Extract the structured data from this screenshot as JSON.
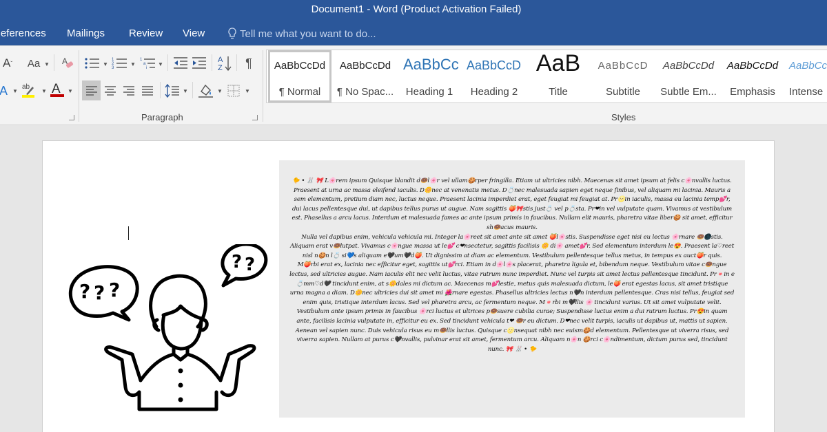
{
  "window": {
    "title": "Document1 - Word (Product Activation Failed)"
  },
  "tabs": [
    {
      "label": "References"
    },
    {
      "label": "Mailings"
    },
    {
      "label": "Review"
    },
    {
      "label": "View"
    }
  ],
  "tell_me": {
    "placeholder": "Tell me what you want to do...",
    "icon": "lightbulb-icon"
  },
  "ribbon": {
    "font_group": {
      "buttons": [
        {
          "name": "grow-font",
          "icon": "font-size-icon",
          "glyph": "A"
        },
        {
          "name": "change-case",
          "icon": "change-case-icon",
          "glyph": "Aa"
        },
        {
          "name": "clear-formatting",
          "icon": "clear-formatting-icon"
        },
        {
          "name": "text-effects",
          "icon": "text-effects-icon",
          "glyph": "A"
        },
        {
          "name": "highlight",
          "icon": "highlighter-icon",
          "glyph": "ab",
          "color": "#ffff00"
        },
        {
          "name": "font-color",
          "icon": "font-color-icon",
          "glyph": "A",
          "color": "#c00000"
        }
      ]
    },
    "paragraph_group": {
      "label": "Paragraph",
      "buttons": [
        {
          "name": "bullets",
          "icon": "bullets-icon"
        },
        {
          "name": "numbering",
          "icon": "numbering-icon"
        },
        {
          "name": "multilevel-list",
          "icon": "multilevel-list-icon"
        },
        {
          "name": "decrease-indent",
          "icon": "decrease-indent-icon"
        },
        {
          "name": "increase-indent",
          "icon": "increase-indent-icon"
        },
        {
          "name": "sort",
          "icon": "sort-az-icon"
        },
        {
          "name": "show-hide",
          "icon": "pilcrow-icon",
          "glyph": "¶"
        },
        {
          "name": "align-left",
          "icon": "align-left-icon",
          "active": true
        },
        {
          "name": "align-center",
          "icon": "align-center-icon"
        },
        {
          "name": "align-right",
          "icon": "align-right-icon"
        },
        {
          "name": "justify",
          "icon": "justify-icon"
        },
        {
          "name": "line-spacing",
          "icon": "line-spacing-icon"
        },
        {
          "name": "shading",
          "icon": "shading-icon"
        },
        {
          "name": "borders",
          "icon": "borders-icon"
        }
      ]
    },
    "styles_group": {
      "label": "Styles",
      "items": [
        {
          "sample": "AaBbCcDd",
          "name": "¶ Normal",
          "selected": true
        },
        {
          "sample": "AaBbCcDd",
          "name": "¶ No Spac..."
        },
        {
          "sample": "AaBbCc",
          "name": "Heading 1"
        },
        {
          "sample": "AaBbCcD",
          "name": "Heading 2"
        },
        {
          "sample": "AaB",
          "name": "Title"
        },
        {
          "sample": "AaBbCcD",
          "name": "Subtitle"
        },
        {
          "sample": "AaBbCcDd",
          "name": "Subtle Em..."
        },
        {
          "sample": "AaBbCcDd",
          "name": "Emphasis"
        },
        {
          "sample": "AaBbCc",
          "name": "Intense"
        }
      ]
    }
  },
  "document": {
    "paragraphs": [
      "🐤 • 🐰 🎀 L🌸rem ipsum Quisque blandit d🍩l🌸r vel ullam🍪rper fringilla. Etiam ut ultricies nibh. Maecenas sit amet ipsum at felis c🌸nvallis luctus. Praesent at urna ac massa eleifend iaculis. D🌼nec at venenatis metus. D💍nec malesuada sapien eget neque finibus, vel aliquam mi lacinia. Mauris a sem elementum, pretium diam nec, luctus neque. Praesent lacinia imperdiet erat, eget feugiat mi feugiat at. Pr🌝in iaculis, massa eu lacinia temp💕r, dui lacus pellentesque dui, ut dapibus tellus purus ut augue. Nam sagittis 🍑🎀stis just💍 vel p💍sta. Pr❤in vel vulputate quam. Vivamus at vestibulum est. Phasellus a arcu lacus. Interdum et malesuada fames ac ante ipsum primis in faucibus. Nullam elit mauris, pharetra vitae liber🍪 sit amet, efficitur sh🍩acus mauris.",
      "Nulla vel dapibus enim, vehicula vehicula mi. Integer la🌸reet sit amet ante sit amet 🍑l🌸stis. Suspendisse eget nisi eu lectus 🌸rnare 🍩🌑stis. Aliquam erat v🍩lutpat. Vivamus c🌸ngue massa ut le💕 c❤nsectetur, sagittis facilisis 🌼 di🌸 amet💕r. Sed elementum interdum le😍. Praesent la♡reet nisl n🍪n l💍 si💙s aliquam e🖤um🖤d🍑. Ut dignissim at diam ac elementum. Vestibulum pellentesque tellus metus, in tempus ex auct🍑r quis.",
      "M🍑rbi erat ex, lacinia nec efficitur eget, sagittis ut💕rci. Etiam in d🌸l🌸s placerat, pharetra ligula et, bibendum neque. Vestibulum vitae c🍩ngue lectus, sed ultricies augue. Nam iaculis elit nec velit luctus, vitae rutrum nunc imperdiet. Nunc vel turpis sit amet lectus pellentesque tincidunt. Pr🍬in e💍mm♡d🖤 tincidunt enim, at s🌼dales mi dictum ac. Maecenas m💕lestie, metus quis malesuada dictum, le🍑 erat egestas lacus, sit amet tristique urna magna a diam. D🌼nec ultricies dui sit amet mi 🌺rnare egestas. Phasellus ultricies lectus n🖤n interdum pellentesque. Cras nisi tellus, feugiat sed enim quis, tristique interdum lacus. Sed vel pharetra arcu, ac fermentum neque. M🍬rbi m🖤llis 🌸 tincidunt varius. Ut sit amet vulputate velit.",
      "Vestibulum ante ipsum primis in faucibus 🌸rci luctus et ultrices p🍩suere cubilia curae; Suspendisse luctus enim a dui rutrum luctus. Pr😍in quam ante, facilisis lacinia vulputate in, efficitur eu ex. Sed tincidunt vehicula t❤ 🍩r eu dictum. D❤nec velit turpis, iaculis ut dapibus ut, mattis ut sapien. Aenean vel sapien nunc. Duis vehicula risus eu m🍩llis luctus. Quisque c🌝nsequat nibh nec euism🍪d elementum. Pellentesque ut viverra risus, sed viverra sapien. Nullam at purus c🖤nvallis, pulvinar erat sit amet, fermentum arcu. Aliquam n🌸n 🍪rci c🌸ndimentum, dictum purus sed, tincidunt nunc. 🎀 🐰 • 🐤"
    ],
    "illustration": "confused-person-with-question-bubbles"
  }
}
